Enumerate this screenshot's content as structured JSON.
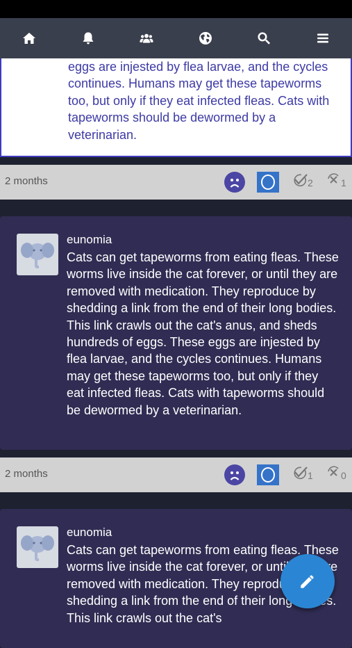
{
  "navbar": {
    "items": [
      {
        "icon": "home-icon"
      },
      {
        "icon": "bell-icon"
      },
      {
        "icon": "users-icon"
      },
      {
        "icon": "globe-icon"
      },
      {
        "icon": "search-icon"
      },
      {
        "icon": "menu-icon"
      }
    ]
  },
  "posts": [
    {
      "text_partial": "eggs are injested by flea larvae, and the cycles continues. Humans may get these tapeworms too, but only if they eat infected fleas. Cats with tapeworms should be dewormed by a veterinarian.",
      "meta": {
        "time": "2 months",
        "agree_count": "2",
        "disagree_count": "1"
      }
    },
    {
      "username": "eunomia",
      "text": "Cats can get tapeworms from eating fleas. These worms live inside the cat forever, or until they are removed with medication. They reproduce by shedding a link from the end of their long bodies. This link crawls out the cat's anus, and sheds hundreds of eggs. These eggs are injested by flea larvae, and the cycles continues. Humans may get these tapeworms too, but only if they eat infected fleas. Cats with tapeworms should be dewormed by a veterinarian.",
      "meta": {
        "time": "2 months",
        "agree_count": "1",
        "disagree_count": "0"
      }
    },
    {
      "username": "eunomia",
      "text": "Cats can get tapeworms from eating fleas. These worms live inside the cat forever, or until they are removed with medication. They reproduce by shedding a link from the end of their long bodies. This link crawls out the cat's"
    }
  ],
  "fab": {
    "icon": "pencil-icon"
  },
  "colors": {
    "navbar": "#3a3f4d",
    "card_dark": "#302c53",
    "accent_blue": "#3573c9",
    "fab": "#2a86d4"
  }
}
